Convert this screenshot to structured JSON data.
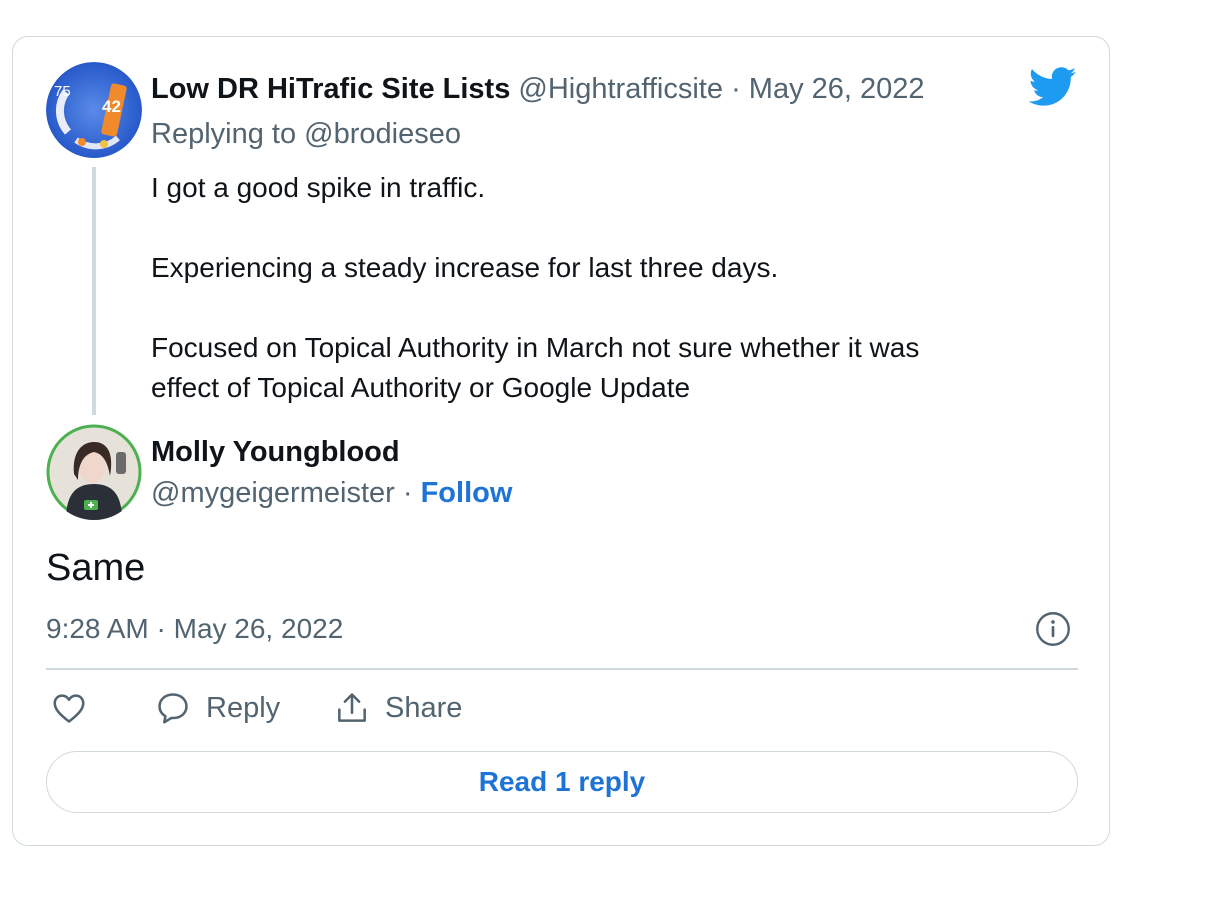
{
  "colors": {
    "accent": "#1d74d6",
    "muted": "#536471",
    "text": "#0f1419",
    "border": "#cfd9de",
    "bird": "#1d9bf0"
  },
  "parent_tweet": {
    "author_name": "Low DR HiTrafic Site Lists",
    "handle": "@Hightrafficsite",
    "separator": "·",
    "date": "May 26, 2022",
    "replying_to": "Replying to @brodieseo",
    "text": "I got a good spike in traffic.\n\nExperiencing a steady increase for last three days.\n\nFocused on Topical Authority in March not sure whether it was\neffect of Topical Authority or Google Update",
    "avatar_icon": "chart-avatar"
  },
  "reply_tweet": {
    "author_name": "Molly Youngblood",
    "handle": "@mygeigermeister",
    "separator": "·",
    "follow_label": "Follow",
    "text": "Same",
    "timestamp": "9:28 AM · May 26, 2022",
    "avatar_icon": "user-avatar"
  },
  "actions": {
    "like_icon": "heart-icon",
    "reply_label": "Reply",
    "reply_icon": "speech-bubble-icon",
    "share_label": "Share",
    "share_icon": "share-icon"
  },
  "read_replies_label": "Read 1 reply",
  "brand_icon": "twitter-bird-icon",
  "info_icon": "info-icon"
}
